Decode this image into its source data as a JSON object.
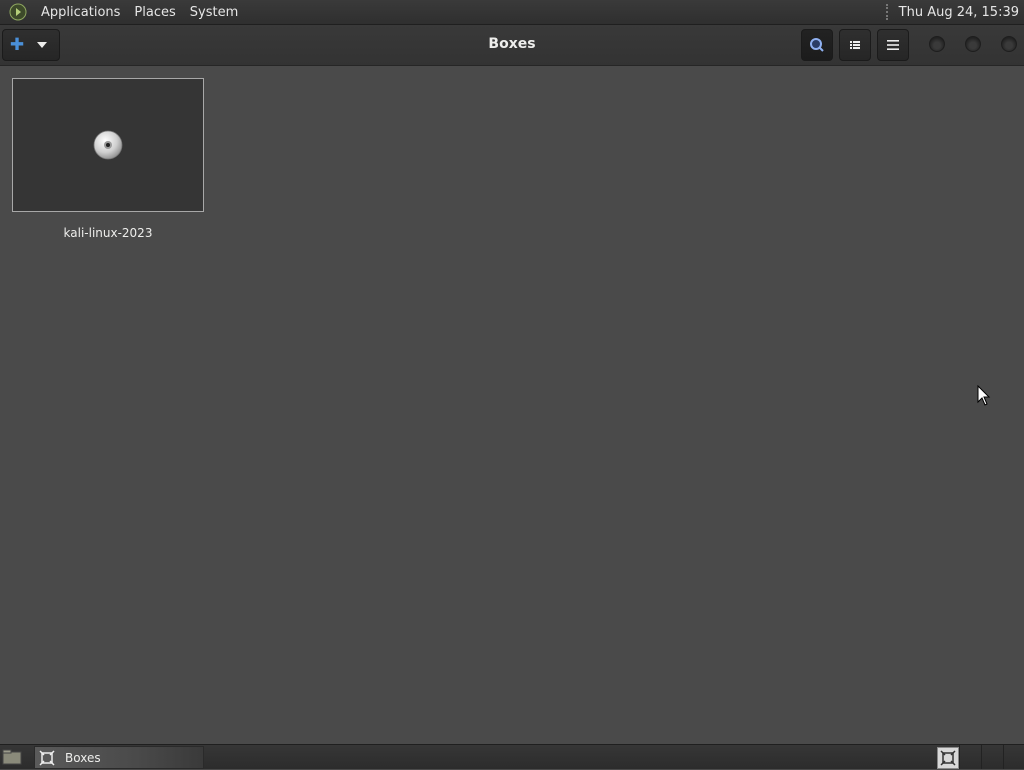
{
  "top_panel": {
    "menus": [
      "Applications",
      "Places",
      "System"
    ],
    "clock": "Thu Aug 24, 15:39"
  },
  "header": {
    "title": "Boxes",
    "icons": {
      "new": "plus-icon",
      "dropdown": "chevron-down-icon",
      "search": "search-icon",
      "view": "list-view-icon",
      "menu": "hamburger-menu-icon"
    }
  },
  "boxes": [
    {
      "name": "kali-linux-2023",
      "icon": "cd-disc-icon"
    }
  ],
  "taskbar": {
    "tasks": [
      {
        "label": "Boxes",
        "icon": "boxes-app-icon"
      }
    ]
  },
  "colors": {
    "accent": "#4a90d9",
    "background": "#4a4a4a",
    "panel": "#2f2f2f",
    "text": "#eeeeec"
  }
}
